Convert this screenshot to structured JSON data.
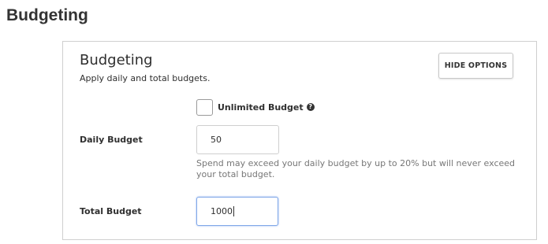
{
  "page": {
    "title": "Budgeting"
  },
  "panel": {
    "title": "Budgeting",
    "subtitle": "Apply daily and total budgets.",
    "hide_options_label": "HIDE OPTIONS"
  },
  "unlimited": {
    "label": "Unlimited Budget",
    "checked": false,
    "help_glyph": "?"
  },
  "daily_budget": {
    "label": "Daily Budget",
    "value": "50",
    "hint": "Spend may exceed your daily budget by up to 20% but will never exceed your total budget."
  },
  "total_budget": {
    "label": "Total Budget",
    "value": "1000",
    "focused": true
  },
  "colors": {
    "focus_border": "#7fa7e8",
    "hint_text": "#777777",
    "panel_border": "#cfcfcf"
  }
}
